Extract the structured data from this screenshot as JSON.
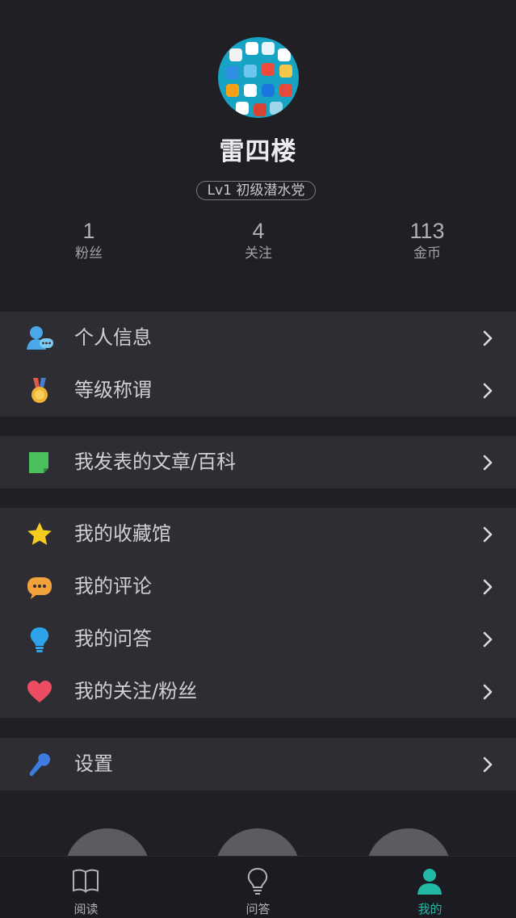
{
  "profile": {
    "username": "雷四楼",
    "level": "Lv1 初级潜水党",
    "stats": [
      {
        "value": "1",
        "label": "粉丝"
      },
      {
        "value": "4",
        "label": "关注"
      },
      {
        "value": "113",
        "label": "金币"
      }
    ]
  },
  "menu": {
    "personal_info": {
      "label": "个人信息",
      "icon": "user-chat-icon"
    },
    "level_title": {
      "label": "等级称谓",
      "icon": "medal-icon"
    },
    "my_articles": {
      "label": "我发表的文章/百科",
      "icon": "document-icon"
    },
    "my_favorites": {
      "label": "我的收藏馆",
      "icon": "star-icon"
    },
    "my_comments": {
      "label": "我的评论",
      "icon": "comment-icon"
    },
    "my_qa": {
      "label": "我的问答",
      "icon": "lightbulb-icon"
    },
    "my_follows": {
      "label": "我的关注/粉丝",
      "icon": "heart-icon"
    },
    "settings": {
      "label": "设置",
      "icon": "wrench-icon"
    }
  },
  "tabbar": {
    "tabs": [
      {
        "label": "阅读",
        "icon": "book-icon",
        "active": false
      },
      {
        "label": "问答",
        "icon": "lightbulb-icon",
        "active": false
      },
      {
        "label": "我的",
        "icon": "person-icon",
        "active": true
      }
    ]
  },
  "colors": {
    "accent": "#23b7a6",
    "background": "#1f1f24",
    "row_background": "#2d2d33"
  }
}
